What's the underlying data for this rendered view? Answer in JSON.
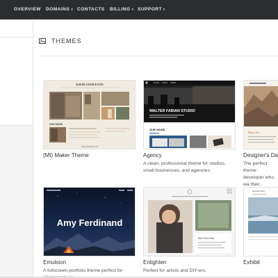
{
  "nav": {
    "items": [
      {
        "label": "OVERVIEW",
        "has_caret": false
      },
      {
        "label": "DOMAINS",
        "has_caret": true
      },
      {
        "label": "CONTACTS",
        "has_caret": false
      },
      {
        "label": "BILLING",
        "has_caret": true
      },
      {
        "label": "SUPPORT",
        "has_caret": true
      }
    ],
    "caret_glyph": "▾"
  },
  "page": {
    "title": "THEMES",
    "title_icon": "image-icon"
  },
  "themes": [
    {
      "name": "(Mt) Maker Theme",
      "description": "",
      "preview": {
        "header_name": "DAVID STAPLETON",
        "sub_heading": "OUR WORK",
        "footer_text": "OUR PRODUCTS"
      }
    },
    {
      "name": "Agency",
      "description": "A clean, professional theme for studios, small businesses, and agencies.",
      "preview": {
        "hero_text": "WALTER FABIAN STUDIO",
        "sub_heading": "OUR WORK"
      }
    },
    {
      "name": "Designer's Dai",
      "description": "The perfect theme developer who wa their..",
      "preview": {
        "hero_text": "Major Ave"
      }
    },
    {
      "name": "Emulsion",
      "description": "A fullscreen portfolio theme perfect for photographers.",
      "preview": {
        "hero_text": "Amy Ferdinand"
      }
    },
    {
      "name": "Enlighten",
      "description": "Perfect for artists and DIY-ers.",
      "preview": {
        "caption": "Mind Cerro Kela"
      }
    },
    {
      "name": "Exhibit",
      "description": "",
      "preview": {
        "caption": "Second Story"
      }
    }
  ],
  "colors": {
    "nav_background": "#2b2d2f",
    "nav_text": "#e6e6e6",
    "sidebar_background": "#f4f4f4",
    "emulsion_background": "#0b1830"
  }
}
